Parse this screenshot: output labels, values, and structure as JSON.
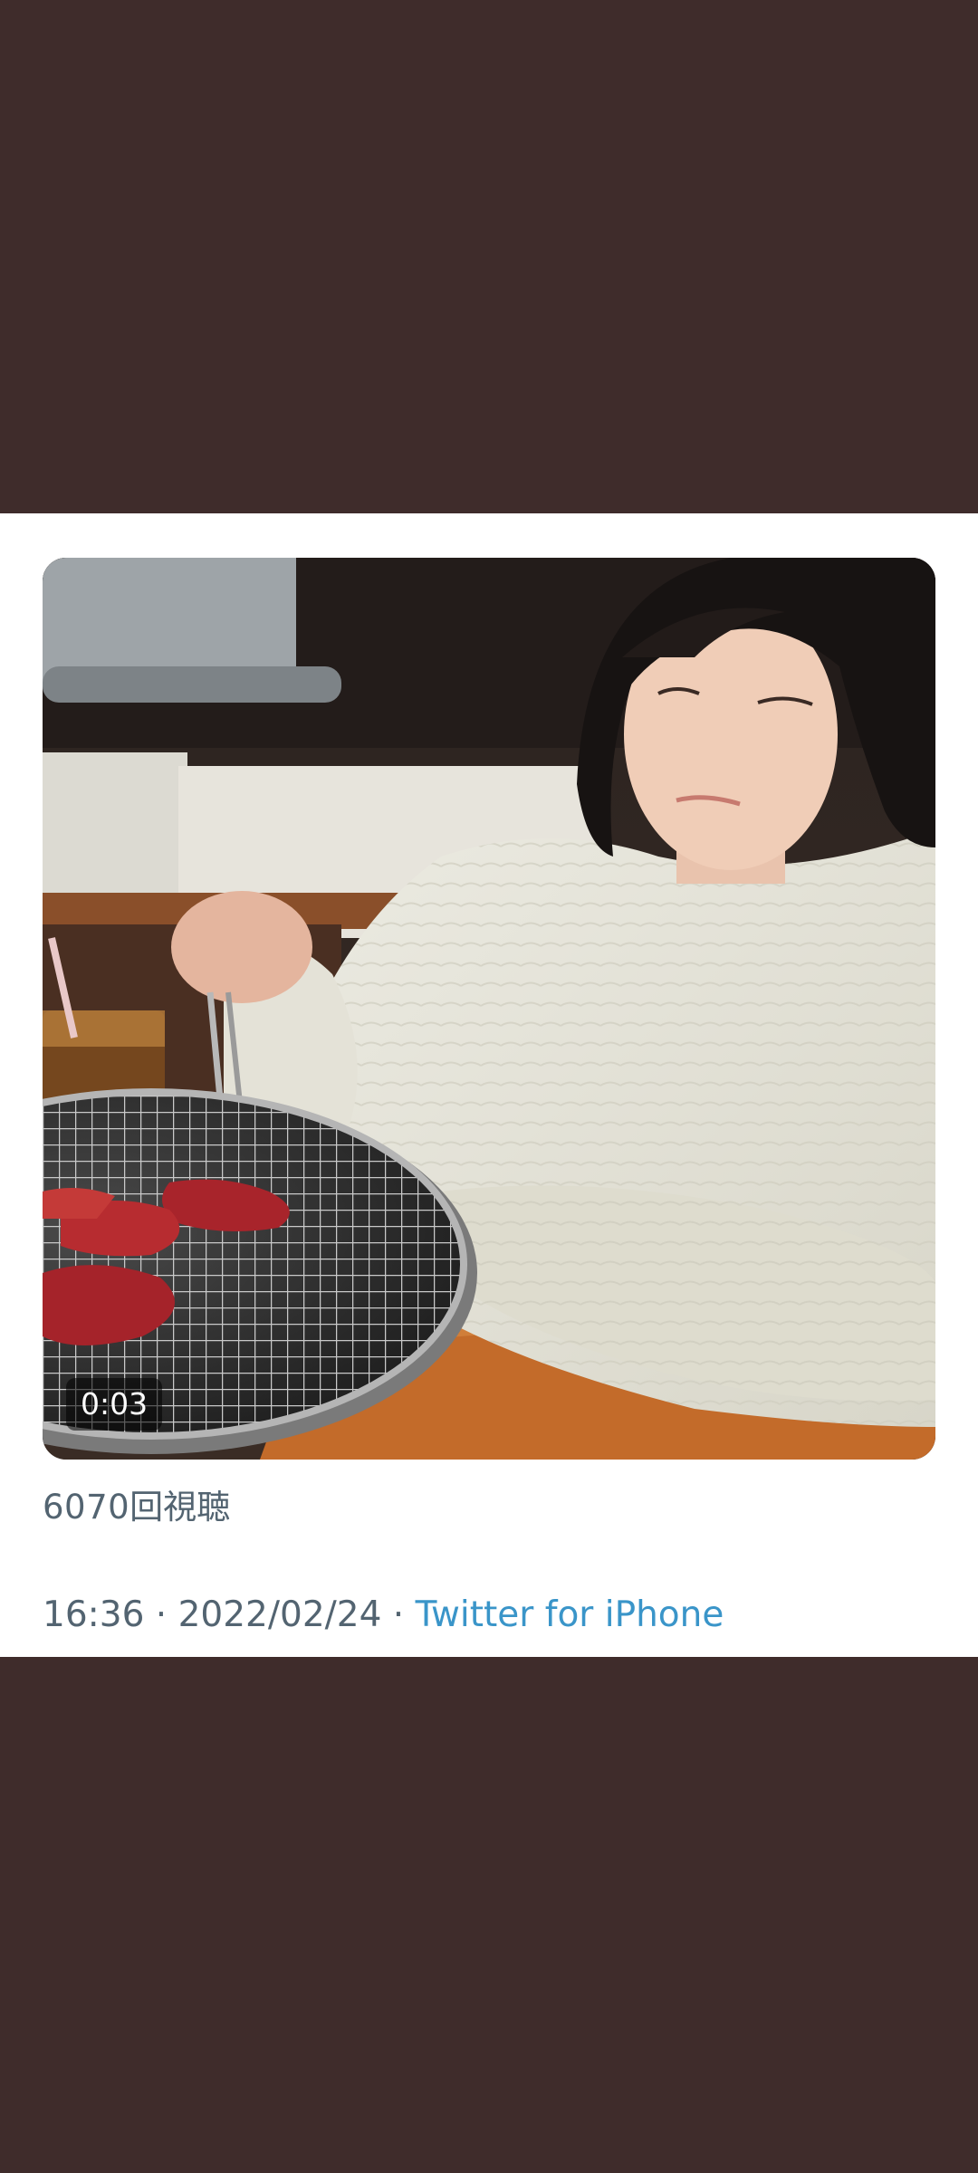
{
  "tweet": {
    "video": {
      "duration": "0:03"
    },
    "views": {
      "count": "6070",
      "label": "回視聴"
    },
    "meta": {
      "time": "16:36",
      "separator": " · ",
      "date": "2022/02/24",
      "source": "Twitter for iPhone"
    }
  },
  "colors": {
    "background": "#3f2c2b",
    "card": "#ffffff",
    "secondary_text": "#536471",
    "link": "#3a95c9"
  }
}
